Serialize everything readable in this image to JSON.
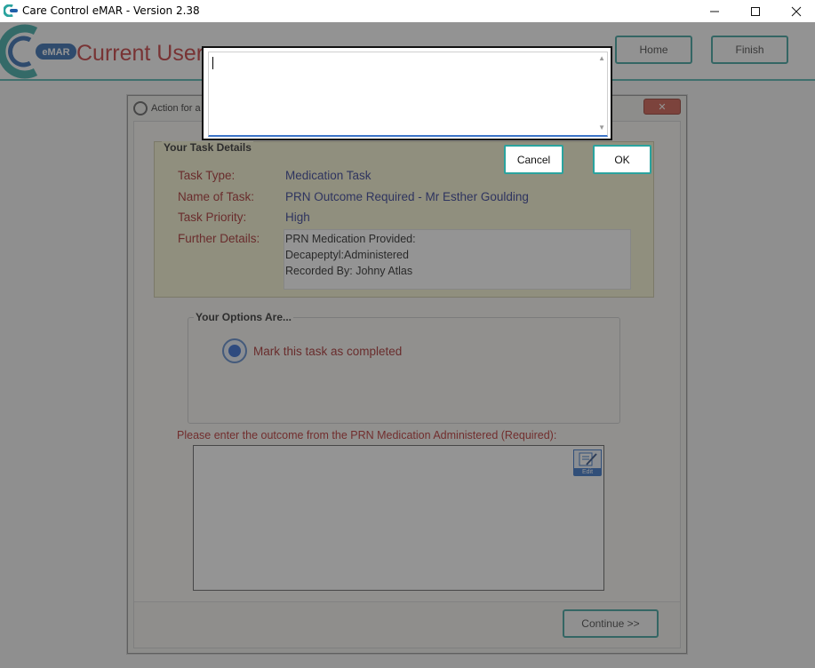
{
  "window": {
    "title": "Care Control eMAR - Version 2.38"
  },
  "header": {
    "logo_text": "eMAR",
    "current_user_label": "Current User",
    "home_label": "Home",
    "finish_label": "Finish"
  },
  "task_dialog": {
    "title": "Action for a",
    "details_legend": "Your Task Details",
    "fields": [
      {
        "label": "Task Type:",
        "value": "Medication Task"
      },
      {
        "label": "Name of Task:",
        "value": "PRN Outcome Required - Mr Esther Goulding"
      },
      {
        "label": "Task Priority:",
        "value": "High"
      },
      {
        "label": "Further Details:"
      }
    ],
    "further_details_lines": [
      "PRN Medication Provided:",
      "Decapeptyl:Administered",
      "Recorded By: Johny Atlas"
    ],
    "options_legend": "Your Options Are...",
    "option_completed": "Mark this task as completed",
    "outcome_prompt": "Please enter the outcome from the PRN Medication Administered (Required):",
    "edit_icon_caption": "Edit",
    "continue_label": "Continue >>"
  },
  "input_popup": {
    "value": "",
    "cancel_label": "Cancel",
    "ok_label": "OK"
  },
  "colors": {
    "accent_teal": "#2a9a95",
    "label_red": "#a01a1a",
    "value_blue": "#1d2a8a",
    "details_bg": "#f7f3cf"
  }
}
